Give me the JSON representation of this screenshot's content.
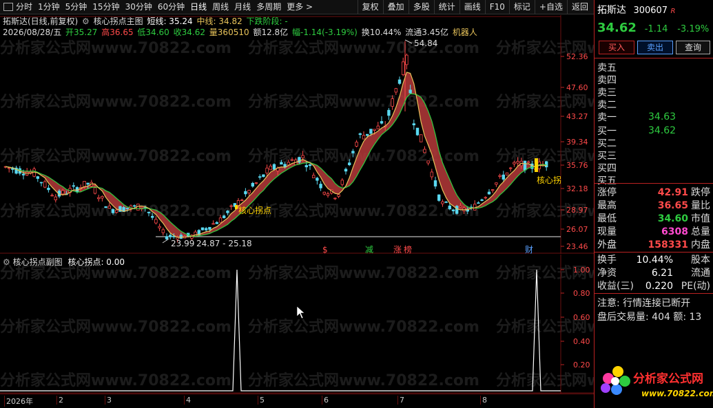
{
  "toolbar": {
    "periods": [
      "分时",
      "1分钟",
      "5分钟",
      "15分钟",
      "30分钟",
      "60分钟",
      "日线",
      "周线",
      "月线",
      "多周期",
      "更多 >"
    ],
    "active_period": "日线",
    "actions": [
      "复权",
      "叠加",
      "多股",
      "统计",
      "画线",
      "F10",
      "标记",
      "+自选",
      "返回"
    ]
  },
  "chart_header": {
    "line1_name": "拓斯达(日线,前复权)",
    "line1_indicator": "核心拐点主图",
    "short_label": "短线: 35.24",
    "mid_label": "中线: 34.82",
    "phase_label": "下跌阶段: -",
    "date": "2026/08/28/五",
    "open": "开35.27",
    "high": "高36.65",
    "low": "低34.60",
    "close": "收34.62",
    "volume": "量360510",
    "amount": "额12.8亿",
    "change": "幅-1.14(-3.19%)",
    "turnover": "换10.44%",
    "float_cap": "流通3.45亿",
    "concept": "机器人"
  },
  "main_axis": [
    "52.36",
    "47.60",
    "43.27",
    "39.34",
    "35.76",
    "32.18",
    "28.97",
    "26.07",
    "23.46"
  ],
  "annotations": {
    "peak": "54.84",
    "low_label": "23.99",
    "range_label": "24.87 - 25.18",
    "signal_left": "核心拐点",
    "signal_right": "核心拐",
    "markers": [
      "$",
      "减",
      "涨",
      "榜",
      "财"
    ]
  },
  "sub_header": {
    "name": "核心拐点副图",
    "value_label": "核心拐点: 0.00"
  },
  "sub_axis": [
    "1.00",
    "0.80",
    "0.60",
    "0.40",
    "0.20"
  ],
  "time_axis": [
    "2026年",
    "2",
    "3",
    "4",
    "5",
    "6",
    "7",
    "8"
  ],
  "stock": {
    "name": "拓斯达",
    "code": "300607",
    "tag": "R",
    "price": "34.62",
    "change": "-1.14",
    "change_pct": "-3.19%"
  },
  "buttons": {
    "buy": "买入",
    "sell": "卖出",
    "query": "查询"
  },
  "order_book": {
    "sell": [
      {
        "label": "卖五",
        "value": ""
      },
      {
        "label": "卖四",
        "value": ""
      },
      {
        "label": "卖三",
        "value": ""
      },
      {
        "label": "卖二",
        "value": ""
      },
      {
        "label": "卖一",
        "value": "34.63"
      }
    ],
    "buy": [
      {
        "label": "买一",
        "value": "34.62"
      },
      {
        "label": "买二",
        "value": ""
      },
      {
        "label": "买三",
        "value": ""
      },
      {
        "label": "买四",
        "value": ""
      },
      {
        "label": "买五",
        "value": ""
      }
    ]
  },
  "stats": [
    {
      "l": "涨停",
      "v": "42.91",
      "vc": "#ff4a4a",
      "r": "跌停"
    },
    {
      "l": "最高",
      "v": "36.65",
      "vc": "#ff4a4a",
      "r": "量比"
    },
    {
      "l": "最低",
      "v": "34.60",
      "vc": "#2ecc40",
      "r": "市值"
    },
    {
      "l": "现量",
      "v": "6308",
      "vc": "#ff4ad0",
      "r": "总量"
    },
    {
      "l": "外盘",
      "v": "158331",
      "vc": "#ff4a4a",
      "r": "内盘"
    }
  ],
  "stats2": [
    {
      "l": "换手",
      "v": "10.44%",
      "r": "股本"
    },
    {
      "l": "净资",
      "v": "6.21",
      "r": "流通"
    },
    {
      "l": "收益(三)",
      "v": "0.220",
      "r": "PE(动)"
    }
  ],
  "notice": {
    "line1": "注意: 行情连接已断开",
    "line2": "盘后交易量: 404  额: 13"
  },
  "logo": {
    "text": "分析家公式网",
    "url_text": "www.70822.com"
  },
  "watermark_text": "分析家公式网www.70822.com",
  "colors": {
    "up": "#ff4a4a",
    "down": "#2ecc40",
    "ma": "#e8c35a",
    "band": "#b53a3a",
    "bg": "#000000"
  }
}
